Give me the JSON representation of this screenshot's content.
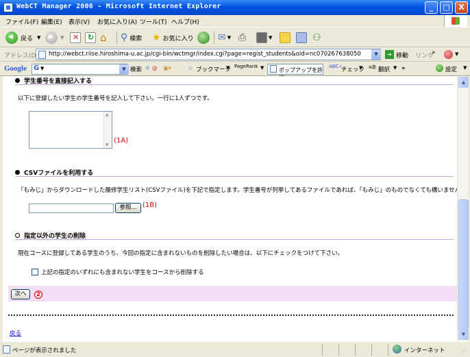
{
  "window": {
    "title": "WebCT Manager 2006 - Microsoft Internet Explorer",
    "minimize": "_",
    "maximize": "□",
    "close": "X"
  },
  "menu": [
    "ファイル(F)",
    "編集(E)",
    "表示(V)",
    "お気に入り(A)",
    "ツール(T)",
    "ヘルプ(H)"
  ],
  "toolbar": {
    "back_label": "戻る",
    "search_label": "検索",
    "favorites_label": "お気に入り"
  },
  "address": {
    "label": "アドレス(D)",
    "url": "http://webct.riise.hiroshima-u.ac.jp/cgi-bin/wctmgr/index.cgi?page=regist_students&oid=nc070267638050",
    "go_label": "移動",
    "links_label": "リンク"
  },
  "googlebar": {
    "logo": "Google",
    "search_label": "検索",
    "bookmarks_label": "ブックマーク",
    "pagerank_label": "PageRank",
    "popup_label": "ポップアップを許可",
    "check_label": "チェック",
    "translate_label": "翻訳",
    "settings_label": "設定"
  },
  "page": {
    "section1": {
      "title": "学生番号を直接記入する",
      "instruction": "以下に登録したい学生の学生番号を記入して下さい。一行に1人ずつです。",
      "marker": "(1A)"
    },
    "section2": {
      "title": "CSVファイルを利用する",
      "instruction": "「もみじ」からダウンロードした履修学生リスト(CSVファイル)を下記で指定します。学生番号が列挙してあるファイルであれば、「もみじ」のものでなくても構いません。",
      "browse_label": "参照...",
      "marker": "(1B)"
    },
    "section3": {
      "title": "指定以外の学生の削除",
      "instruction": "現在コースに登録してある学生のうち、今回の指定に含まれないものを削除したい場合は、以下にチェックをつけて下さい。",
      "checkbox_label": "上記の指定のいずれにも含まれない学生をコースから削除する"
    },
    "next_label": "次へ",
    "next_marker": "2",
    "back_link": "戻る"
  },
  "status": {
    "text": "ページが表示されました",
    "zone": "インターネット"
  }
}
